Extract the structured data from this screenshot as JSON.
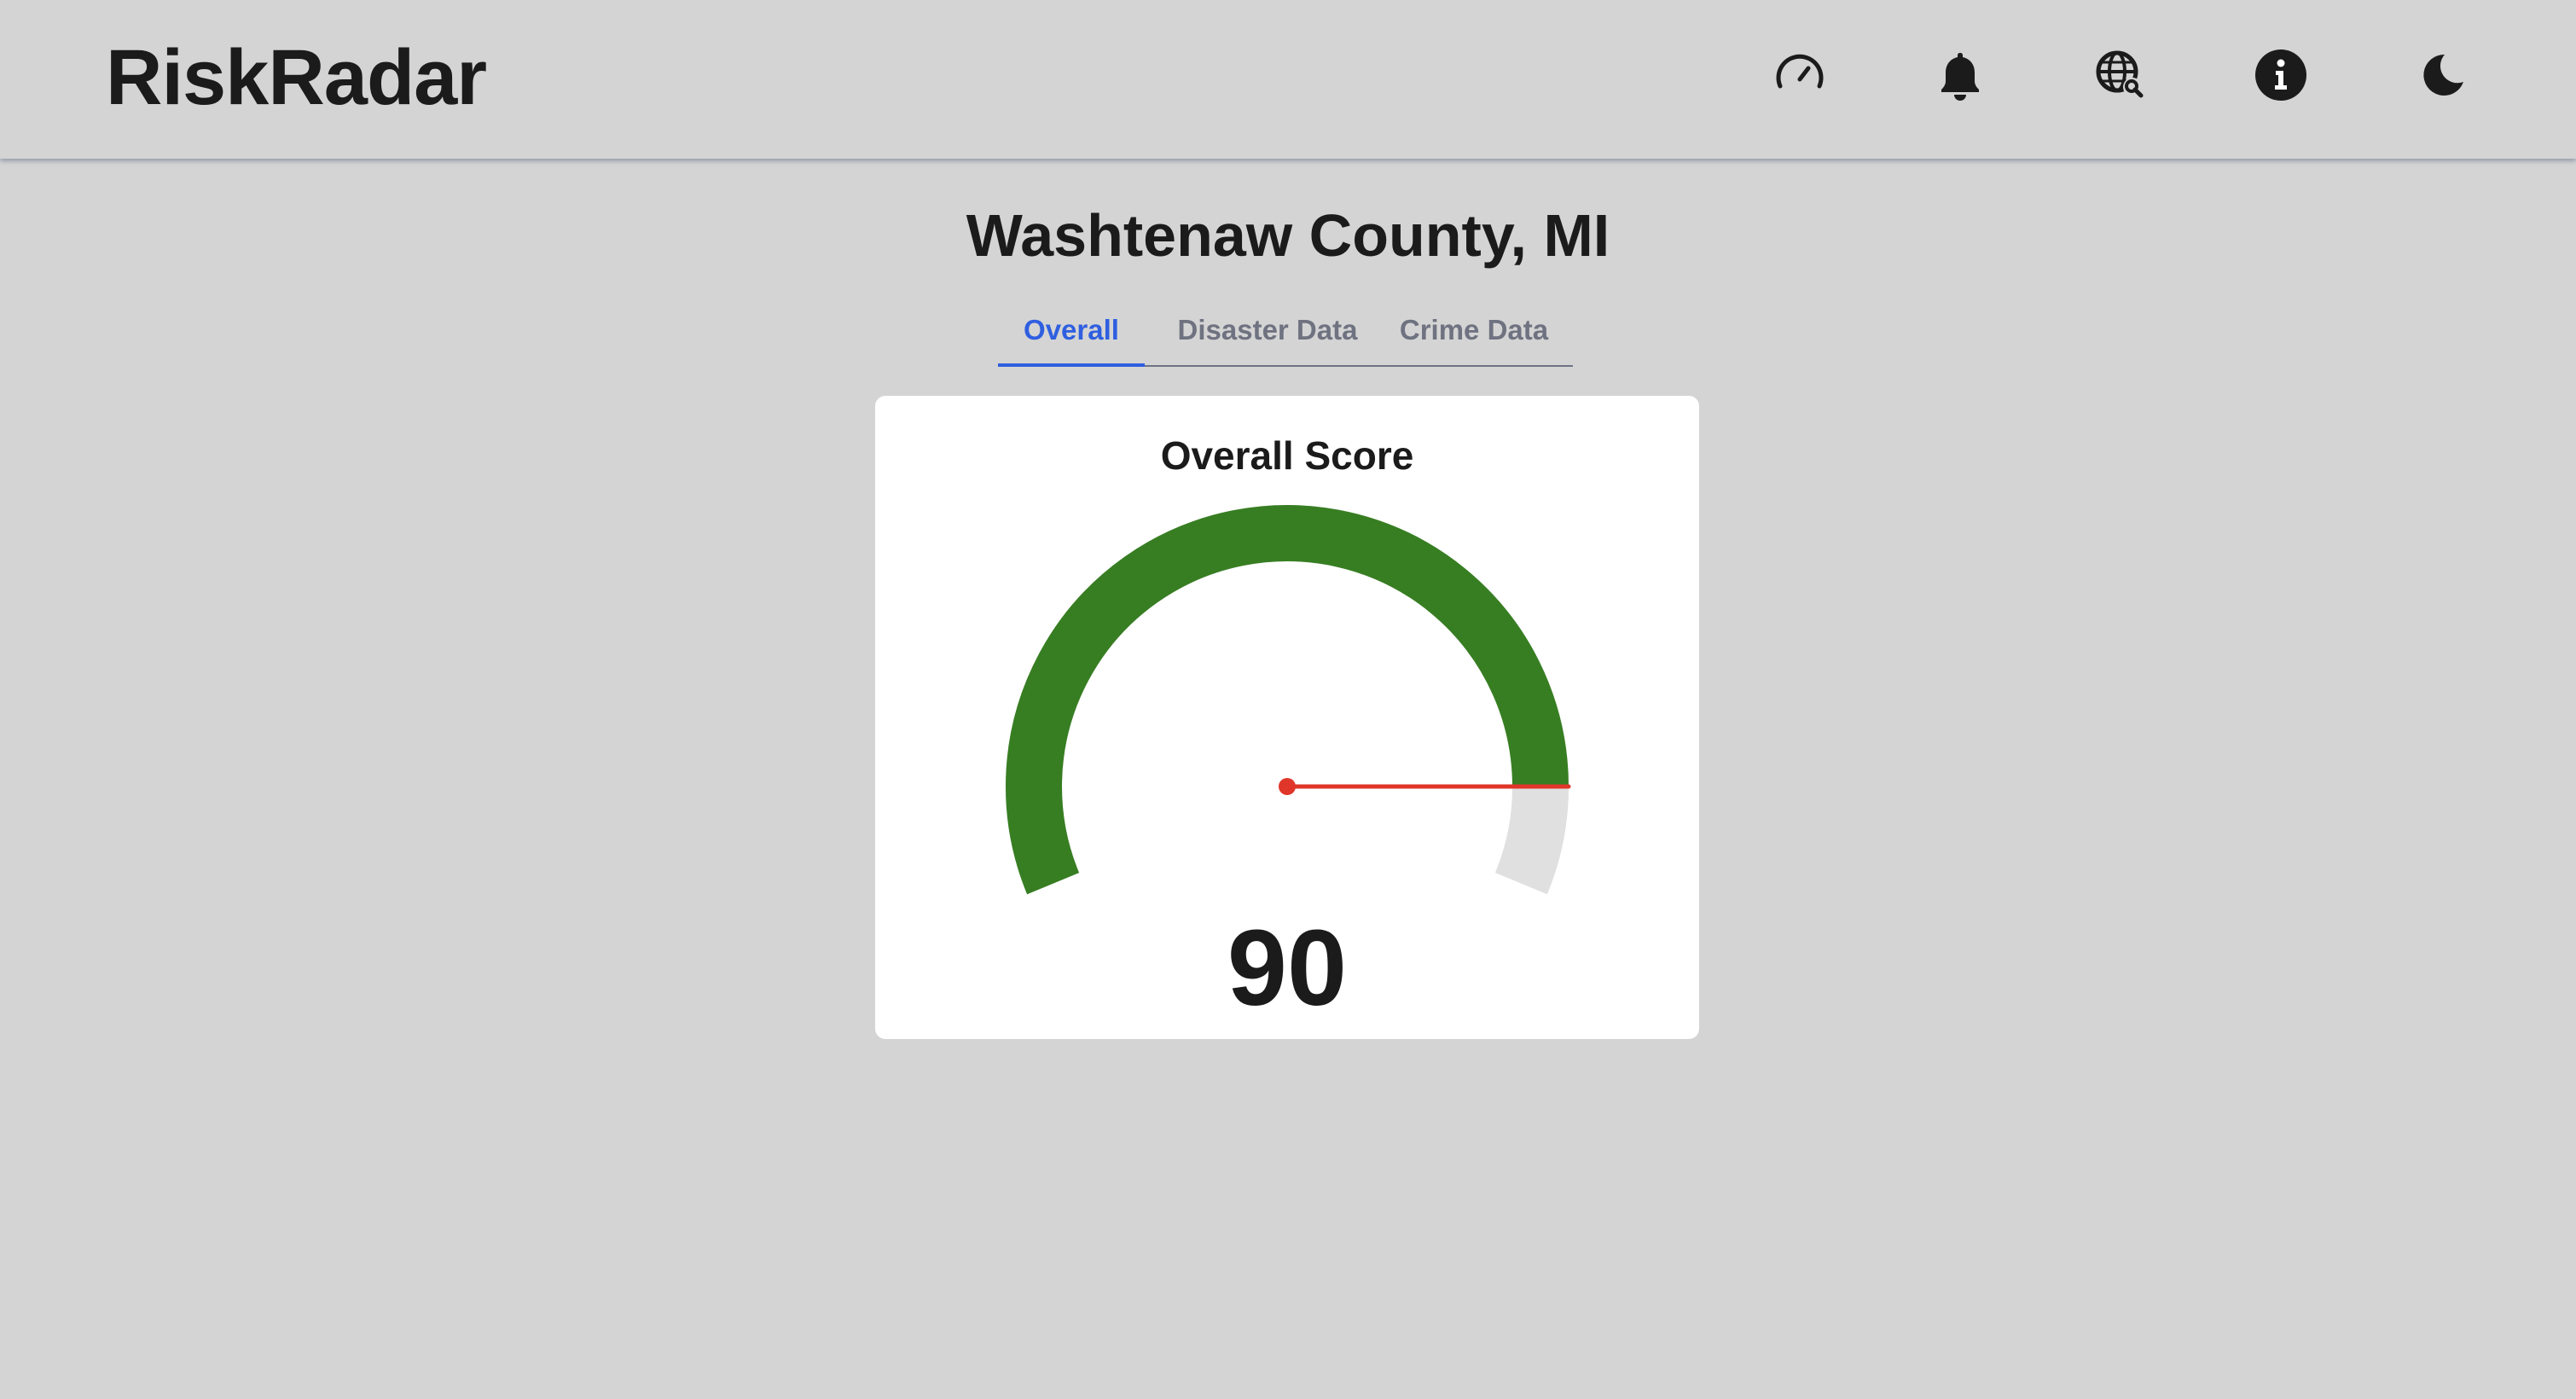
{
  "app": {
    "title": "RiskRadar"
  },
  "nav": {
    "icons": [
      {
        "name": "speedometer-icon"
      },
      {
        "name": "bell-icon"
      },
      {
        "name": "globe-search-icon"
      },
      {
        "name": "info-icon"
      },
      {
        "name": "moon-icon"
      }
    ]
  },
  "location": {
    "title": "Washtenaw County, MI"
  },
  "tabs": [
    {
      "label": "Overall",
      "active": true
    },
    {
      "label": "Disaster Data",
      "active": false
    },
    {
      "label": "Crime Data",
      "active": false
    }
  ],
  "score_card": {
    "title": "Overall Score",
    "score": "90",
    "value": 90,
    "min": 0,
    "max": 100,
    "colors": {
      "fill": "#377e22",
      "track": "#e0e0e0",
      "needle": "#e0362a"
    }
  }
}
